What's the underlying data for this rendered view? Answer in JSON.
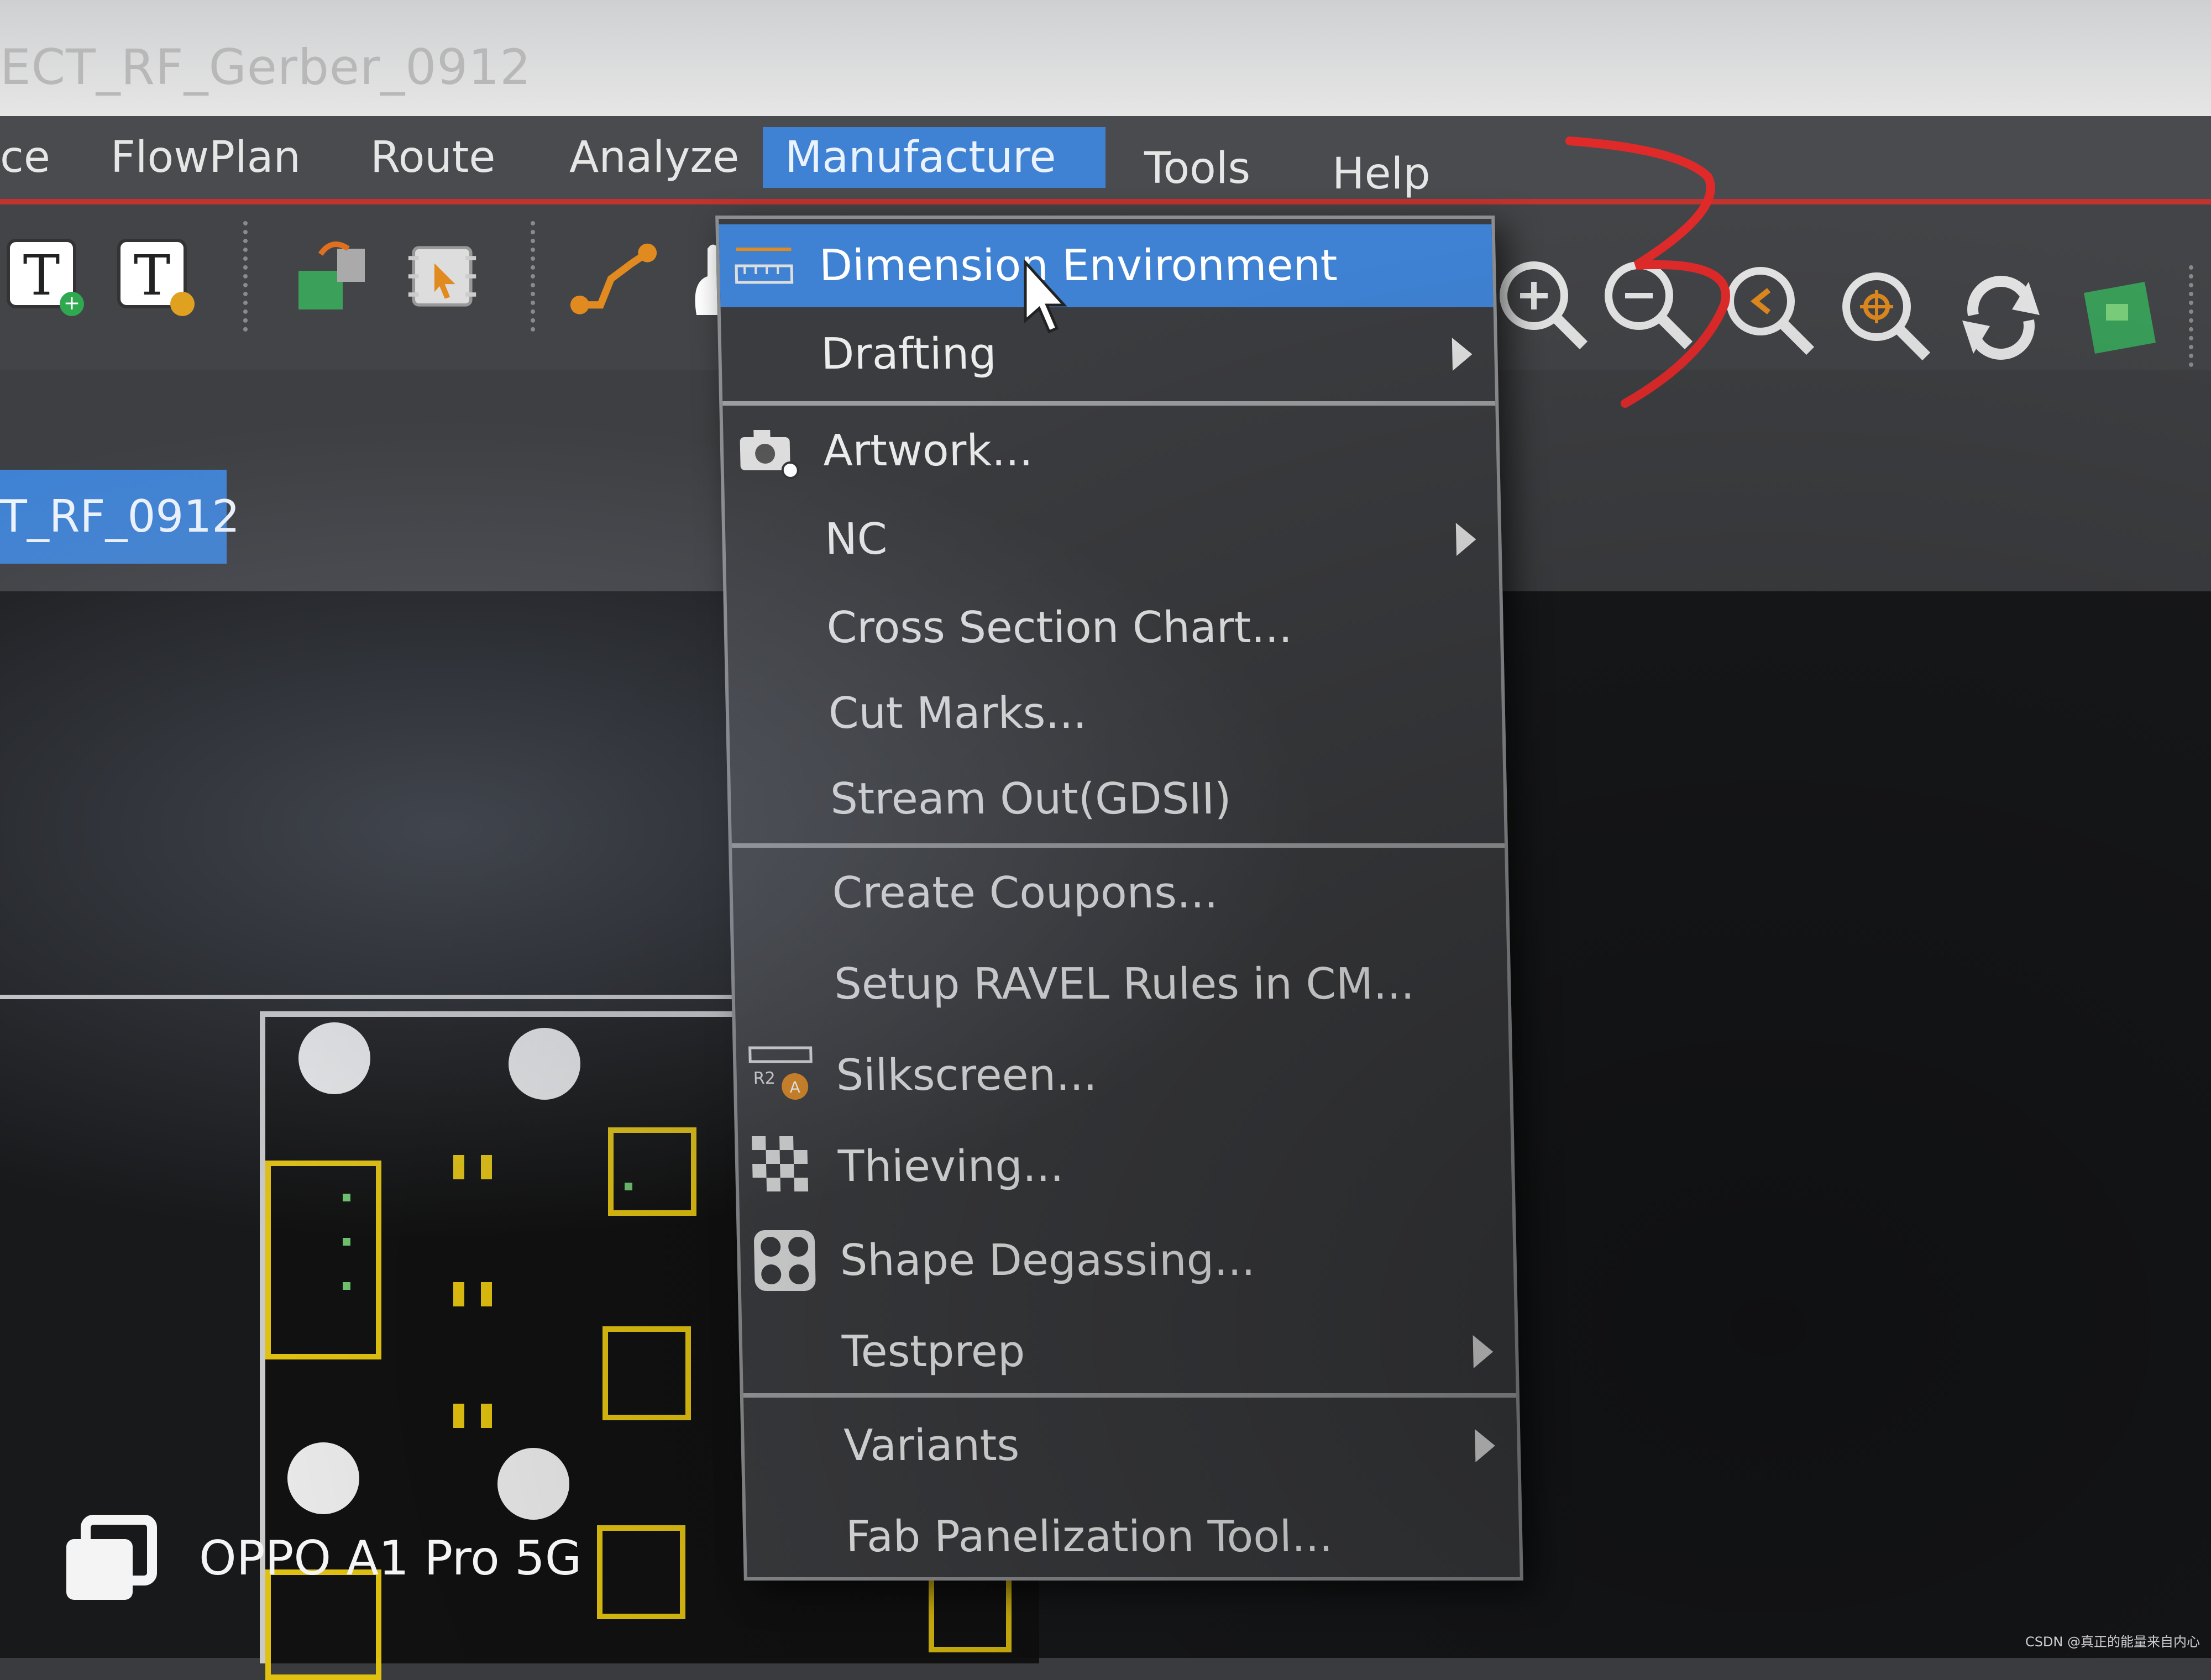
{
  "window": {
    "title": "ECT_RF_Gerber_0912"
  },
  "menubar": {
    "items": [
      {
        "label": "ce",
        "left": "0"
      },
      {
        "label": "FlowPlan"
      },
      {
        "label": "Route"
      },
      {
        "label": "Analyze"
      },
      {
        "label": "Manufacture",
        "active": true
      },
      {
        "label": "Tools"
      },
      {
        "label": "Help"
      }
    ]
  },
  "tab": {
    "label": "T_RF_0912"
  },
  "dropdown": {
    "items": [
      {
        "label": "Dimension Environment",
        "highlight": true,
        "icon": "ruler-icon",
        "submenu": false
      },
      {
        "label": "Drafting",
        "submenu": true
      },
      {
        "label": "Artwork...",
        "icon": "camera-icon"
      },
      {
        "label": "NC",
        "submenu": true
      },
      {
        "label": "Cross Section Chart..."
      },
      {
        "label": "Cut Marks..."
      },
      {
        "label": "Stream Out(GDSII)"
      },
      {
        "label": "Create Coupons..."
      },
      {
        "label": "Setup RAVEL Rules in CM..."
      },
      {
        "label": "Silkscreen...",
        "icon": "silkscreen-icon"
      },
      {
        "label": "Thieving...",
        "icon": "thieving-icon"
      },
      {
        "label": "Shape Degassing...",
        "icon": "degassing-icon"
      },
      {
        "label": "Testprep",
        "submenu": true
      },
      {
        "label": "Variants",
        "submenu": true
      },
      {
        "label": "Fab Panelization Tool..."
      }
    ]
  },
  "watermark": {
    "text": "OPPO A1 Pro 5G"
  },
  "credit": {
    "text": "CSDN @真正的能量来自内心"
  },
  "colors": {
    "accent": "#3f82d4",
    "menu_bg": "#4a4b4f",
    "dropdown_bg": "#3b3c3f",
    "annotation": "#e02a2a",
    "component": "#e0c010"
  }
}
